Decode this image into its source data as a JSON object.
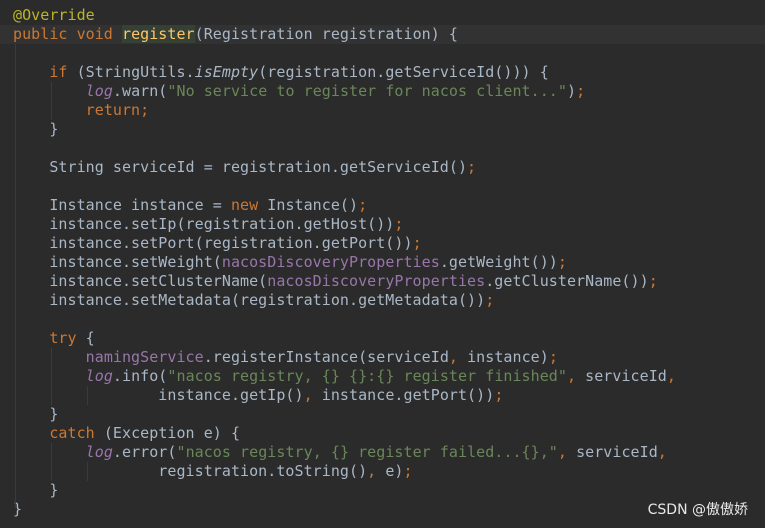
{
  "editor": {
    "theme_colors": {
      "background": "#2b2b2b",
      "keyword": "#cc7832",
      "string": "#6a8759",
      "field": "#9876aa",
      "annotation": "#bbb529",
      "method_decl": "#ffc66d",
      "text": "#a9b7c6"
    },
    "current_line": 1,
    "lines": [
      [
        [
          "ann",
          "@Override"
        ]
      ],
      [
        [
          "kw",
          "public void "
        ],
        [
          "caret",
          ""
        ],
        [
          "decl",
          "register"
        ],
        [
          "",
          "(Registration registration) {"
        ]
      ],
      [],
      [
        [
          "",
          "    "
        ],
        [
          "kw",
          "if "
        ],
        [
          "",
          "(StringUtils."
        ],
        [
          "smeth",
          "isEmpty"
        ],
        [
          "",
          "(registration.getServiceId())) {"
        ]
      ],
      [
        [
          "",
          "        "
        ],
        [
          "sfld",
          "log"
        ],
        [
          "",
          ".warn("
        ],
        [
          "str",
          "\"No service to register for nacos client...\""
        ],
        [
          "",
          ")"
        ],
        [
          "kw",
          ";"
        ]
      ],
      [
        [
          "",
          "        "
        ],
        [
          "kw",
          "return;"
        ]
      ],
      [
        [
          "",
          "    }"
        ]
      ],
      [],
      [
        [
          "",
          "    String serviceId = registration.getServiceId()"
        ],
        [
          "kw",
          ";"
        ]
      ],
      [],
      [
        [
          "",
          "    Instance instance = "
        ],
        [
          "kw",
          "new "
        ],
        [
          "",
          "Instance()"
        ],
        [
          "kw",
          ";"
        ]
      ],
      [
        [
          "",
          "    instance.setIp(registration.getHost())"
        ],
        [
          "kw",
          ";"
        ]
      ],
      [
        [
          "",
          "    instance.setPort(registration.getPort())"
        ],
        [
          "kw",
          ";"
        ]
      ],
      [
        [
          "",
          "    instance.setWeight("
        ],
        [
          "fld",
          "nacosDiscoveryProperties"
        ],
        [
          "",
          ".getWeight())"
        ],
        [
          "kw",
          ";"
        ]
      ],
      [
        [
          "",
          "    instance.setClusterName("
        ],
        [
          "fld",
          "nacosDiscoveryProperties"
        ],
        [
          "",
          ".getClusterName())"
        ],
        [
          "kw",
          ";"
        ]
      ],
      [
        [
          "",
          "    instance.setMetadata(registration.getMetadata())"
        ],
        [
          "kw",
          ";"
        ]
      ],
      [],
      [
        [
          "",
          "    "
        ],
        [
          "kw",
          "try "
        ],
        [
          "",
          "{"
        ]
      ],
      [
        [
          "",
          "        "
        ],
        [
          "fld",
          "namingService"
        ],
        [
          "",
          ".registerInstance(serviceId"
        ],
        [
          "kw",
          ", "
        ],
        [
          "",
          "instance)"
        ],
        [
          "kw",
          ";"
        ]
      ],
      [
        [
          "",
          "        "
        ],
        [
          "sfld",
          "log"
        ],
        [
          "",
          ".info("
        ],
        [
          "str",
          "\"nacos registry, {} {}:{} register finished\""
        ],
        [
          "kw",
          ", "
        ],
        [
          "",
          "serviceId"
        ],
        [
          "kw",
          ","
        ]
      ],
      [
        [
          "",
          "                instance.getIp()"
        ],
        [
          "kw",
          ", "
        ],
        [
          "",
          "instance.getPort())"
        ],
        [
          "kw",
          ";"
        ]
      ],
      [
        [
          "",
          "    }"
        ]
      ],
      [
        [
          "",
          "    "
        ],
        [
          "kw",
          "catch "
        ],
        [
          "",
          "(Exception e) {"
        ]
      ],
      [
        [
          "",
          "        "
        ],
        [
          "sfld",
          "log"
        ],
        [
          "",
          ".error("
        ],
        [
          "str",
          "\"nacos registry, {} register failed...{},\""
        ],
        [
          "kw",
          ", "
        ],
        [
          "",
          "serviceId"
        ],
        [
          "kw",
          ","
        ]
      ],
      [
        [
          "",
          "                registration.toString()"
        ],
        [
          "kw",
          ", "
        ],
        [
          "",
          "e)"
        ],
        [
          "kw",
          ";"
        ]
      ],
      [
        [
          "",
          "    }"
        ]
      ],
      [
        [
          "",
          "}"
        ]
      ]
    ]
  },
  "watermark": "CSDN @傲傲娇"
}
